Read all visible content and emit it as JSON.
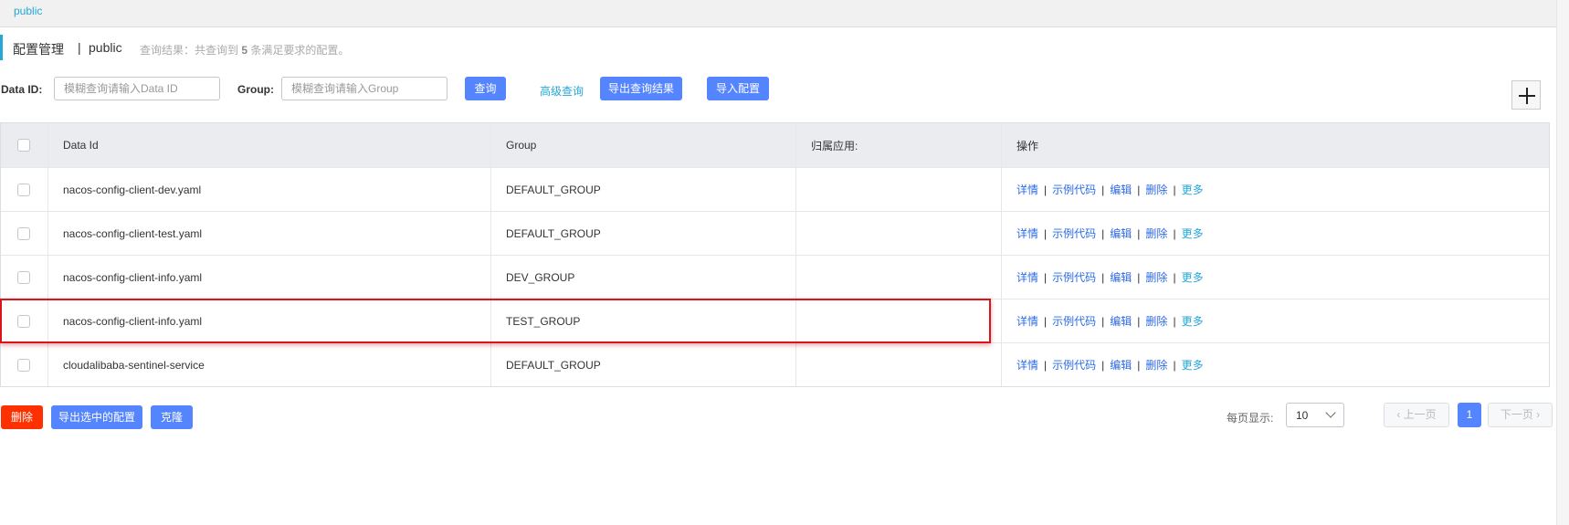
{
  "namespace_tab": "public",
  "title": {
    "main": "配置管理",
    "separator": "|",
    "namespace": "public",
    "result_prefix": "查询结果：共查询到",
    "result_count": "5",
    "result_suffix": "条满足要求的配置。"
  },
  "search": {
    "data_id_label": "Data ID:",
    "data_id_placeholder": "模糊查询请输入Data ID",
    "group_label": "Group:",
    "group_placeholder": "模糊查询请输入Group",
    "query_button": "查询",
    "advanced_link": "高级查询",
    "export_button": "导出查询结果",
    "import_button": "导入配置"
  },
  "table": {
    "headers": [
      "Data Id",
      "Group",
      "归属应用:",
      "操作"
    ],
    "rows": [
      {
        "data_id": "nacos-config-client-dev.yaml",
        "group": "DEFAULT_GROUP",
        "app": ""
      },
      {
        "data_id": "nacos-config-client-test.yaml",
        "group": "DEFAULT_GROUP",
        "app": ""
      },
      {
        "data_id": "nacos-config-client-info.yaml",
        "group": "DEV_GROUP",
        "app": ""
      },
      {
        "data_id": "nacos-config-client-info.yaml",
        "group": "TEST_GROUP",
        "app": ""
      },
      {
        "data_id": "cloudalibaba-sentinel-service",
        "group": "DEFAULT_GROUP",
        "app": ""
      }
    ],
    "actions": {
      "detail": "详情",
      "sample": "示例代码",
      "edit": "编辑",
      "delete": "删除",
      "more": "更多",
      "sep": "|"
    }
  },
  "bulk": {
    "delete_button": "删除",
    "export_selected_button": "导出选中的配置",
    "clone_button": "克隆"
  },
  "pagination": {
    "page_size_label": "每页显示:",
    "page_size": "10",
    "prev": "上一页",
    "current": "1",
    "next": "下一页"
  },
  "colors": {
    "accent": "#25a7d8",
    "primary_button": "#5584ff",
    "danger_button": "#ff3000",
    "highlight_box": "#d9141c"
  }
}
